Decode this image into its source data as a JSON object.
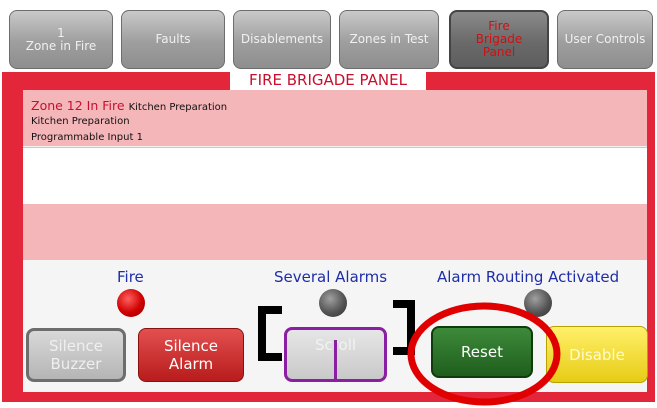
{
  "tabs": [
    {
      "lines": [
        "1",
        "Zone in Fire"
      ]
    },
    {
      "lines": [
        "Faults"
      ]
    },
    {
      "lines": [
        "Disablements"
      ]
    },
    {
      "lines": [
        "Zones in Test"
      ]
    },
    {
      "lines": [
        "Fire",
        "Brigade",
        "Panel"
      ],
      "active": true
    },
    {
      "lines": [
        "User Controls"
      ]
    }
  ],
  "panel": {
    "title": "FIRE BRIGADE PANEL",
    "event": {
      "zone": "Zone 12 In Fire",
      "zone_desc": "Kitchen Preparation",
      "line2": "Kitchen Preparation",
      "line3": "Programmable Input 1"
    }
  },
  "indicators": {
    "fire": {
      "label": "Fire",
      "state": "red"
    },
    "several": {
      "label": "Several Alarms",
      "state": "grey"
    },
    "routing": {
      "label": "Alarm Routing Activated",
      "state": "grey"
    }
  },
  "buttons": {
    "silence_buzzer": {
      "line1": "Silence",
      "line2": "Buzzer"
    },
    "silence_alarm": {
      "line1": "Silence",
      "line2": "Alarm"
    },
    "scroll": "Scroll",
    "reset": "Reset",
    "disable": "Disable"
  },
  "colors": {
    "frame": "#e3263a",
    "title": "#c8102e",
    "indicator_label": "#1f2da8",
    "highlight_ring": "#e00000"
  }
}
